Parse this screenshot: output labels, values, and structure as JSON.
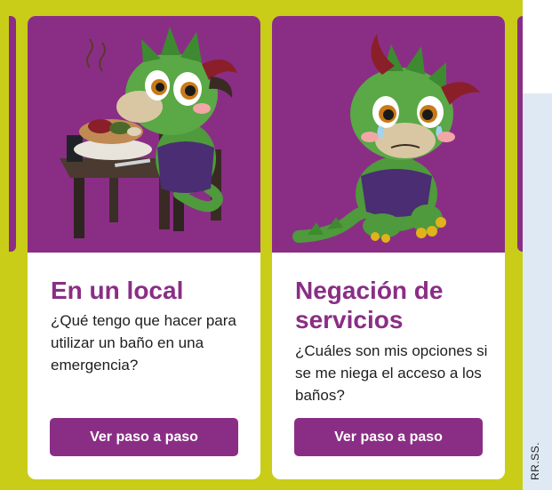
{
  "cards": [
    {
      "title": "En un local",
      "description": "¿Qué tengo que hacer para utilizar un baño en una emergencia?",
      "button_label": "Ver paso a paso",
      "illustration": "dragon-eating-icon"
    },
    {
      "title": "Negación de servicios",
      "description": "¿Cuáles son mis opciones si se me niega el acceso a los baños?",
      "button_label": "Ver paso a paso",
      "illustration": "dragon-crying-icon"
    }
  ],
  "credit": "RR.SS.",
  "colors": {
    "accent": "#8a2e85",
    "frame": "#c9cd18",
    "background": "#dfe9f4",
    "card": "#ffffff",
    "dragon": "#4e9a3c"
  }
}
